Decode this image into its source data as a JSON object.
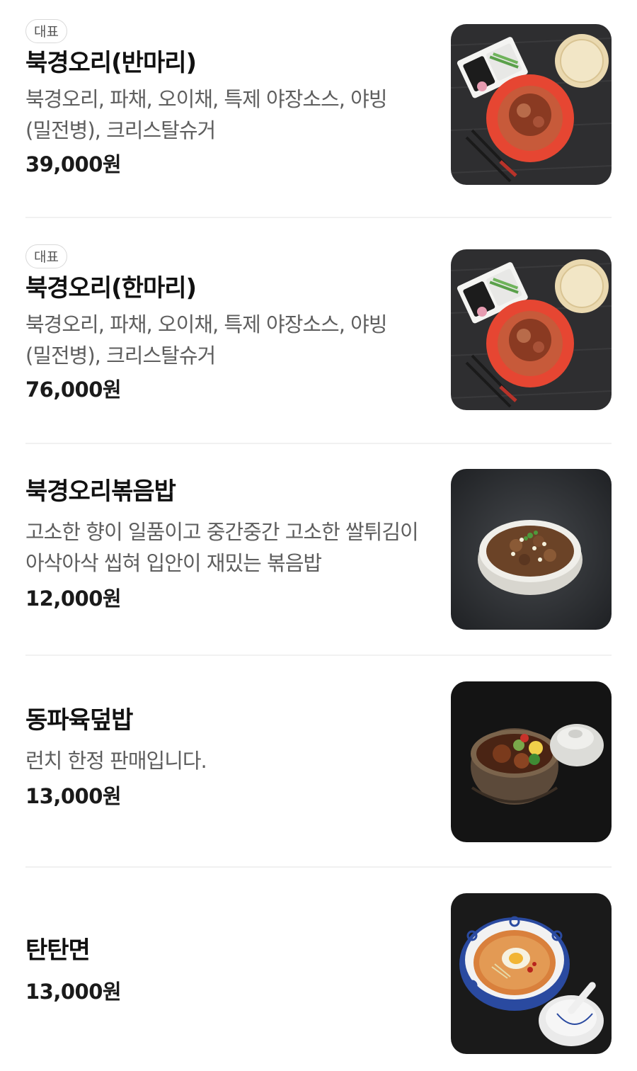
{
  "menu": {
    "items": [
      {
        "badge": "대표",
        "name": "북경오리(반마리)",
        "description": "북경오리, 파채, 오이채, 특제 야장소스, 야빙(밀전병), 크리스탈슈거",
        "price": "39,000원",
        "image_icon": "peking-duck-plate-photo"
      },
      {
        "badge": "대표",
        "name": "북경오리(한마리)",
        "description": "북경오리, 파채, 오이채, 특제 야장소스, 야빙(밀전병), 크리스탈슈거",
        "price": "76,000원",
        "image_icon": "peking-duck-plate-photo"
      },
      {
        "name": "북경오리볶음밥",
        "description": "고소한 향이 일품이고 중간중간 고소한 쌀튀김이 아삭아삭 씹혀 입안이 재밌는 볶음밥",
        "price": "12,000원",
        "image_icon": "fried-rice-bowl-photo"
      },
      {
        "name": "동파육덮밥",
        "description": "런치 한정 판매입니다.",
        "price": "13,000원",
        "image_icon": "dongpo-pork-rice-bowl-photo"
      },
      {
        "name": "탄탄면",
        "price": "13,000원",
        "image_icon": "dandan-noodle-bowl-photo"
      }
    ]
  }
}
